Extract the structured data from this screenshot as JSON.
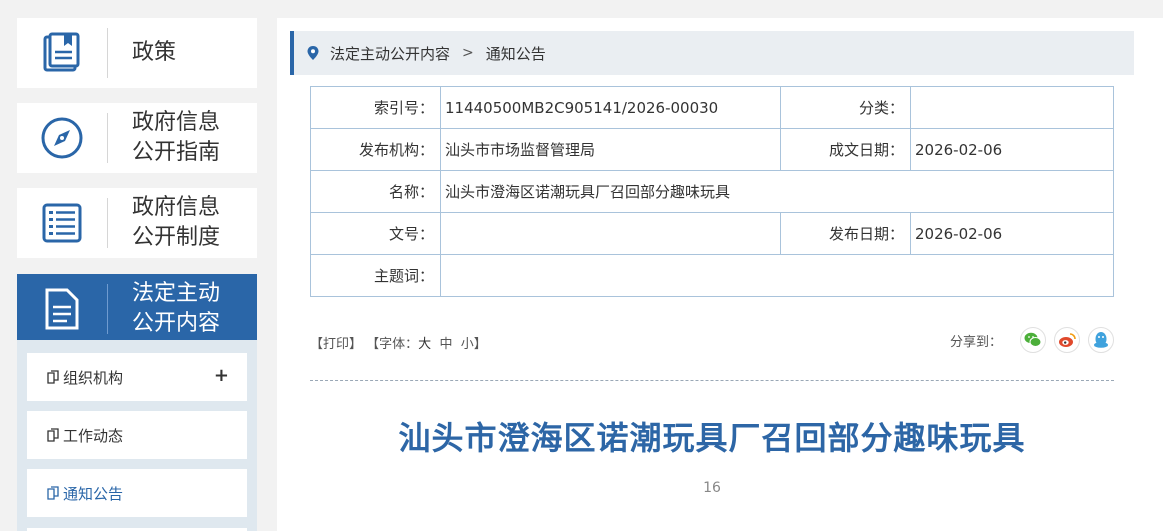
{
  "sidebar": {
    "nav": [
      {
        "label": "政策",
        "icon": "policy-book-icon"
      },
      {
        "label": "政府信息\n公开指南",
        "icon": "compass-icon"
      },
      {
        "label": "政府信息\n公开制度",
        "icon": "list-document-icon"
      },
      {
        "label": "法定主动\n公开内容",
        "icon": "document-icon"
      }
    ],
    "sub_items": [
      {
        "label": "组织机构",
        "expand": "+"
      },
      {
        "label": "工作动态"
      },
      {
        "label": "通知公告"
      }
    ]
  },
  "breadcrumb": {
    "items": [
      "法定主动公开内容",
      "通知公告"
    ],
    "separator": ">"
  },
  "meta": {
    "index_label": "索引号：",
    "index_value": "11440500MB2C905141/2026-00030",
    "category_label": "分类：",
    "category_value": "",
    "publisher_label": "发布机构：",
    "publisher_value": "汕头市市场监督管理局",
    "written_date_label": "成文日期：",
    "written_date_value": "2026-02-06",
    "name_label": "名称：",
    "name_value": "汕头市澄海区诺潮玩具厂召回部分趣味玩具",
    "doc_no_label": "文号：",
    "doc_no_value": "",
    "publish_date_label": "发布日期：",
    "publish_date_value": "2026-02-06",
    "subject_label": "主题词：",
    "subject_value": ""
  },
  "tools": {
    "print": "【打印】",
    "font_prefix": "【字体：",
    "font_large": "大",
    "font_medium": "中",
    "font_small": "小",
    "font_suffix": "】",
    "share_label": "分享到："
  },
  "article": {
    "title": "汕头市澄海区诺潮玩具厂召回部分趣味玩具",
    "views": "16"
  },
  "colors": {
    "accent": "#2a66a8",
    "title": "#2d66a6",
    "wechat": "#4caf3a",
    "weibo": "#e0492c",
    "qq": "#3fa2dd"
  }
}
